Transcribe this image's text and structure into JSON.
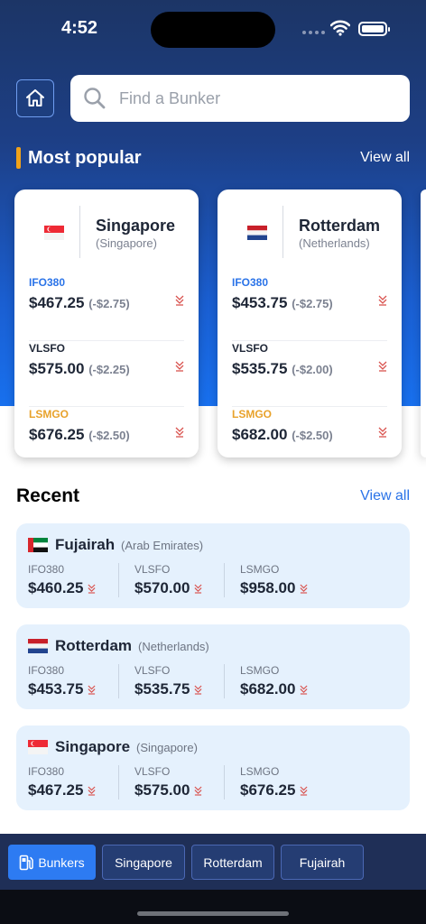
{
  "status": {
    "time": "4:52"
  },
  "search": {
    "placeholder": "Find a Bunker"
  },
  "popular": {
    "title": "Most popular",
    "view_all": "View all",
    "cards": [
      {
        "name": "Singapore",
        "country": "(Singapore)",
        "flag": "singapore-flag",
        "fuels": [
          {
            "label": "IFO380",
            "price": "$467.25",
            "change": "(-$2.75)",
            "color": "#2a73e8"
          },
          {
            "label": "VLSFO",
            "price": "$575.00",
            "change": "(-$2.25)",
            "color": "#1e2636"
          },
          {
            "label": "LSMGO",
            "price": "$676.25",
            "change": "(-$2.50)",
            "color": "#e8a22b"
          }
        ]
      },
      {
        "name": "Rotterdam",
        "country": "(Netherlands)",
        "flag": "netherlands-flag",
        "fuels": [
          {
            "label": "IFO380",
            "price": "$453.75",
            "change": "(-$2.75)",
            "color": "#2a73e8"
          },
          {
            "label": "VLSFO",
            "price": "$535.75",
            "change": "(-$2.00)",
            "color": "#1e2636"
          },
          {
            "label": "LSMGO",
            "price": "$682.00",
            "change": "(-$2.50)",
            "color": "#e8a22b"
          }
        ]
      }
    ]
  },
  "recent": {
    "title": "Recent",
    "view_all": "View all",
    "items": [
      {
        "name": "Fujairah",
        "country": "(Arab Emirates)",
        "flag": "uae-flag",
        "fuels": [
          {
            "label": "IFO380",
            "price": "$460.25"
          },
          {
            "label": "VLSFO",
            "price": "$570.00"
          },
          {
            "label": "LSMGO",
            "price": "$958.00"
          }
        ]
      },
      {
        "name": "Rotterdam",
        "country": "(Netherlands)",
        "flag": "netherlands-flag",
        "fuels": [
          {
            "label": "IFO380",
            "price": "$453.75"
          },
          {
            "label": "VLSFO",
            "price": "$535.75"
          },
          {
            "label": "LSMGO",
            "price": "$682.00"
          }
        ]
      },
      {
        "name": "Singapore",
        "country": "(Singapore)",
        "flag": "singapore-flag",
        "fuels": [
          {
            "label": "IFO380",
            "price": "$467.25"
          },
          {
            "label": "VLSFO",
            "price": "$575.00"
          },
          {
            "label": "LSMGO",
            "price": "$676.25"
          }
        ]
      }
    ]
  },
  "tabs": [
    {
      "label": "Bunkers",
      "icon": "fuel-pump-icon",
      "active": true
    },
    {
      "label": "Singapore"
    },
    {
      "label": "Rotterdam"
    },
    {
      "label": "Fujairah"
    }
  ],
  "colors": {
    "accent": "#f0a21a",
    "primary": "#2a73e8",
    "down": "#d9534f"
  }
}
